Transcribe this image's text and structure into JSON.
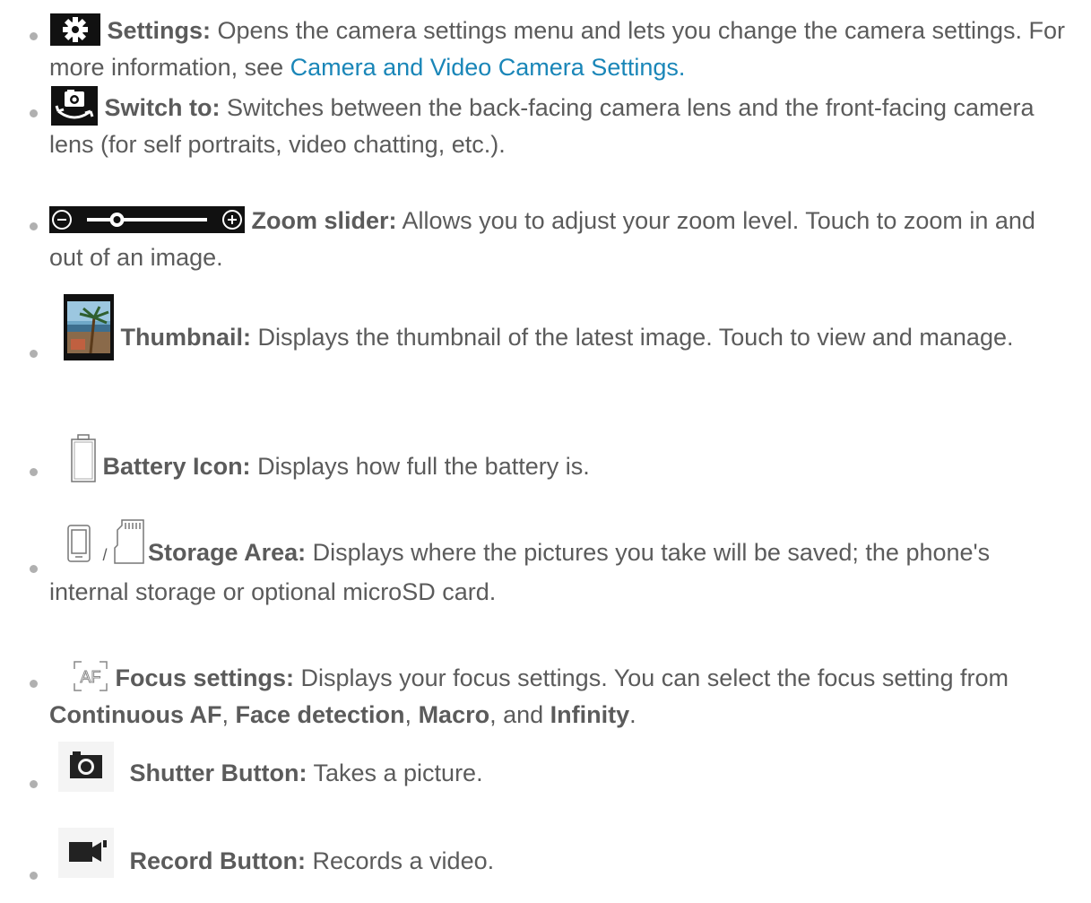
{
  "items": [
    {
      "icon": "gear-icon",
      "term": "Settings:",
      "text_before_link": " Opens the camera settings menu and lets you change the camera settings. For more information, see ",
      "link": "Camera and Video Camera Settings."
    },
    {
      "icon": "switch-camera-icon",
      "term": "Switch to:",
      "text": " Switches between the back-facing camera lens and the front-facing camera lens (for self portraits, video chatting, etc.)."
    },
    {
      "icon": "zoom-slider-icon",
      "zoom_level": 0.25,
      "term": "Zoom slider:",
      "text": " Allows you to adjust your zoom level. Touch to zoom in and out of an image."
    },
    {
      "icon": "thumbnail-image-icon",
      "term": "Thumbnail:",
      "text": " Displays the thumbnail of the latest image. Touch to view and manage."
    },
    {
      "icon": "battery-icon",
      "term": "Battery Icon:",
      "text": " Displays how full the battery is."
    },
    {
      "icon": "phone-storage-icon",
      "icon2": "microsd-card-icon",
      "separator": "/",
      "term": "Storage Area:",
      "text": " Displays where the pictures you take will be saved; the phone's internal storage or optional microSD card."
    },
    {
      "icon": "focus-af-icon",
      "term": "Focus settings:",
      "text": " Displays your focus settings. You can select the focus setting from ",
      "options": [
        "Continuous AF",
        "Face detection",
        "Macro",
        "Infinity"
      ],
      "sep1": ", ",
      "sep2": ", ",
      "sep3": ", and ",
      "end": "."
    },
    {
      "icon": "shutter-camera-icon",
      "term": "Shutter Button:",
      "text": " Takes a picture."
    },
    {
      "icon": "record-video-icon",
      "term": "Record Button:",
      "text": " Records a video."
    }
  ],
  "colors": {
    "text": "#5b5b5b",
    "link": "#1a86b8",
    "bullet": "#b0b0b0"
  }
}
